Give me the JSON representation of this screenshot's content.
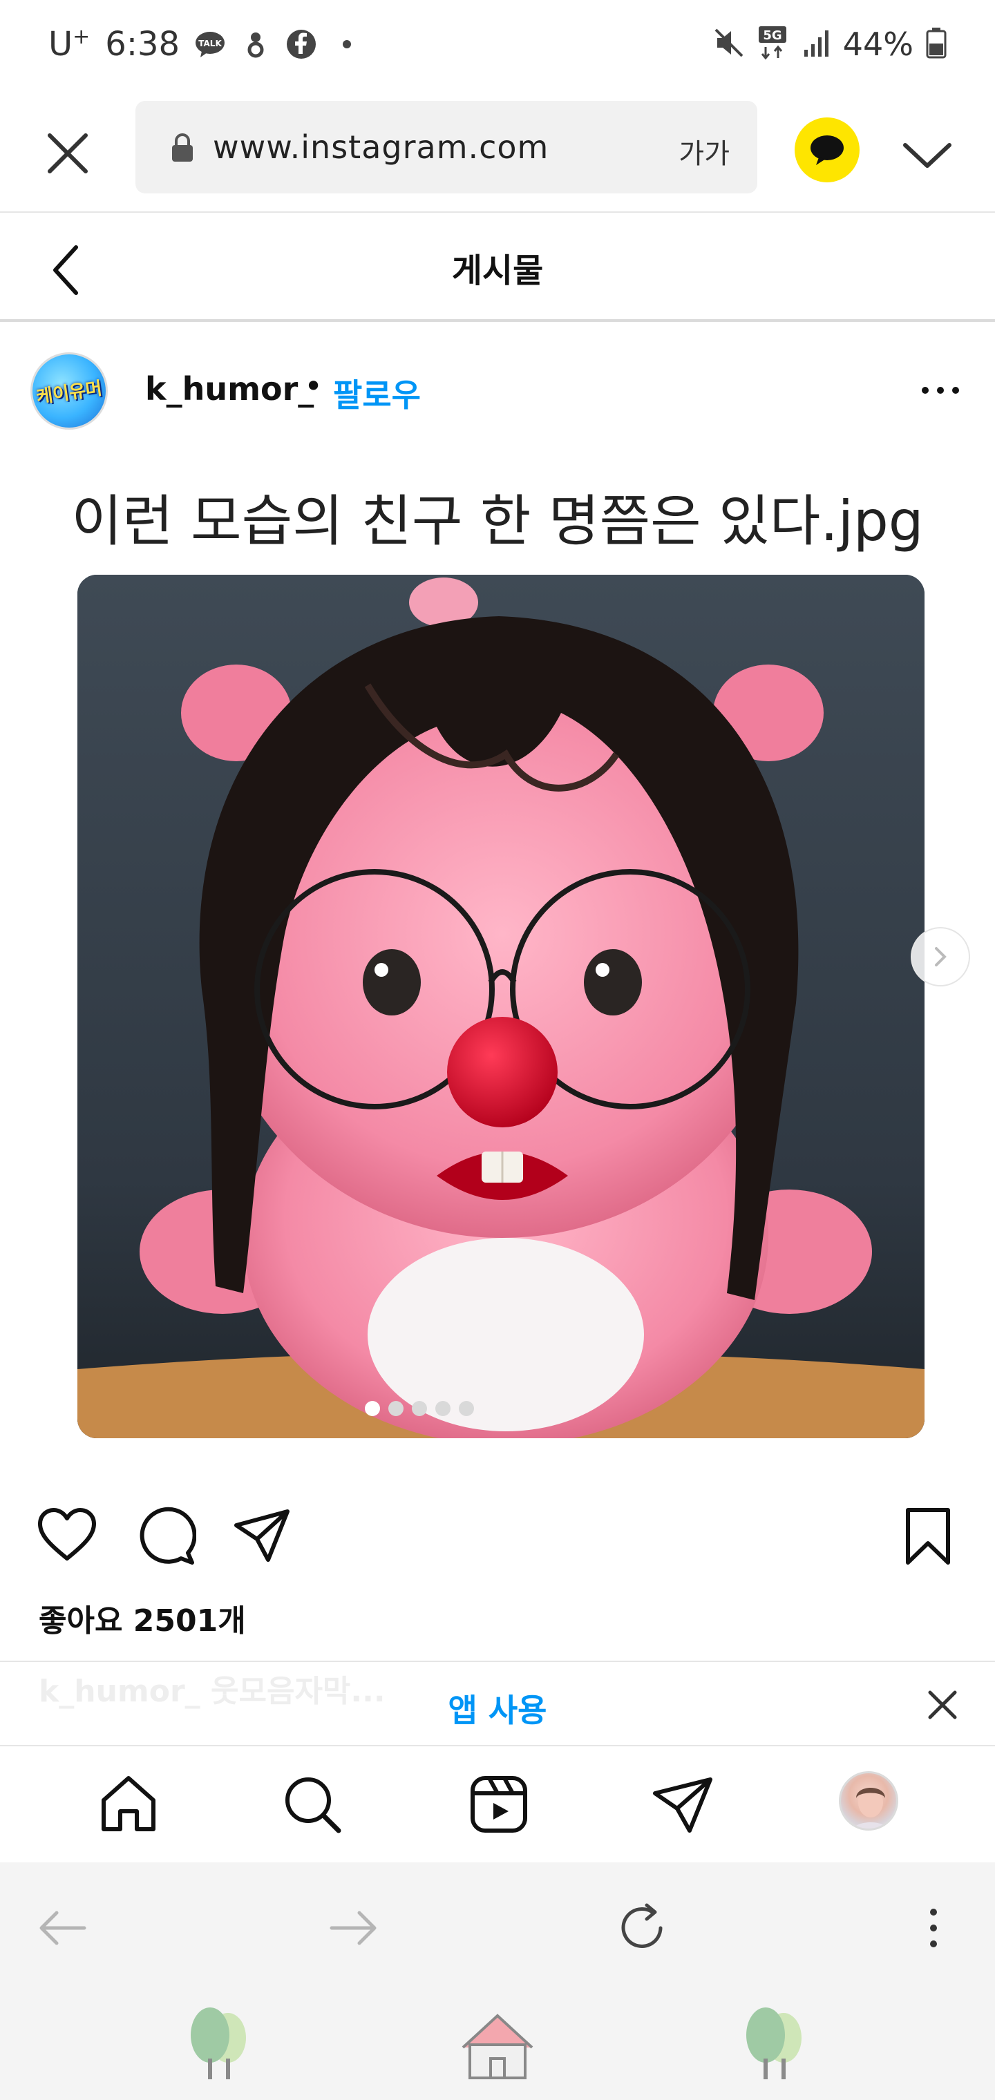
{
  "status_bar": {
    "carrier": "U",
    "carrier_sup": "+",
    "time": "6:38",
    "talk_badge": "TALK",
    "network": "5G",
    "battery": "44%"
  },
  "browser": {
    "url": "www.instagram.com",
    "text_size": "가가"
  },
  "header": {
    "title": "게시물"
  },
  "post": {
    "username": "k_humor_",
    "separator": "•",
    "follow": "팔로우",
    "avatar_text": "케이유머",
    "caption_image_text": "이런 모습의 친구 한 명쯤은 있다.jpg",
    "carousel_count": 5,
    "carousel_active": 1,
    "likes": "좋아요 2501개"
  },
  "app_banner": {
    "ghost_text": "k_humor_ 웃모음자막...",
    "label": "앱 사용"
  },
  "colors": {
    "accent": "#0095f6",
    "kakao_yellow": "#fee500"
  }
}
